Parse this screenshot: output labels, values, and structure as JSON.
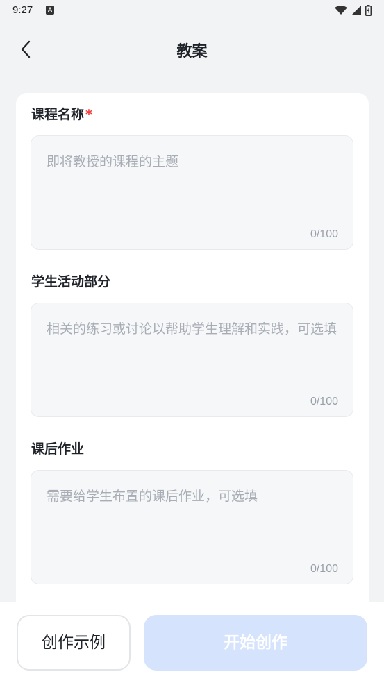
{
  "status_bar": {
    "time": "9:27",
    "notification_icon": "a-icon",
    "right_icons": [
      "wifi-icon",
      "signal-icon",
      "battery-icon"
    ]
  },
  "header": {
    "title": "教案",
    "back_icon": "chevron-left-icon"
  },
  "form": {
    "fields": [
      {
        "label": "课程名称",
        "required": true,
        "placeholder": "即将教授的课程的主题",
        "value": "",
        "counter": "0/100"
      },
      {
        "label": "学生活动部分",
        "required": false,
        "placeholder": "相关的练习或讨论以帮助学生理解和实践，可选填",
        "value": "",
        "counter": "0/100"
      },
      {
        "label": "课后作业",
        "required": false,
        "placeholder": "需要给学生布置的课后作业，可选填",
        "value": "",
        "counter": "0/100"
      }
    ],
    "required_mark": "*"
  },
  "footer": {
    "example_label": "创作示例",
    "start_label": "开始创作"
  },
  "colors": {
    "background": "#f2f3f5",
    "card": "#ffffff",
    "required": "#f23b3b",
    "start_button_disabled": "#d6e3fd"
  }
}
